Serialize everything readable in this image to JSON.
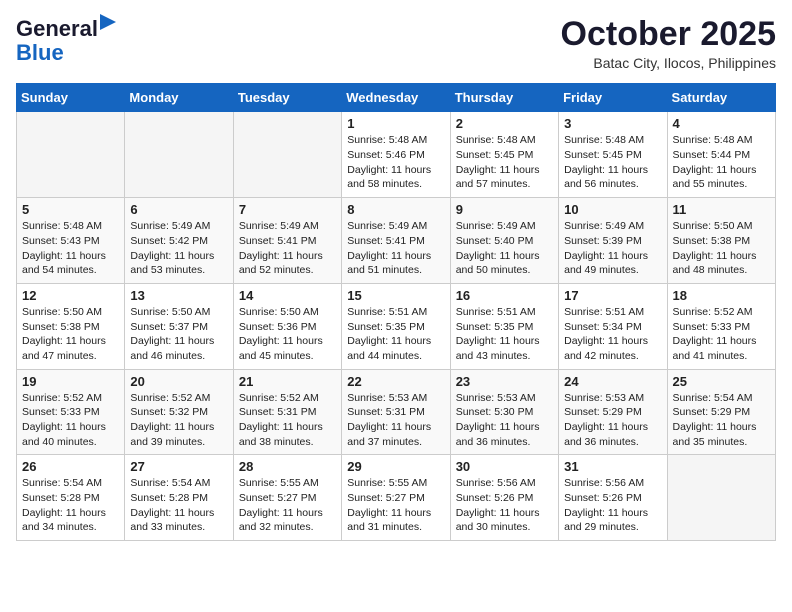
{
  "header": {
    "logo_line1": "General",
    "logo_line2": "Blue",
    "month": "October 2025",
    "location": "Batac City, Ilocos, Philippines"
  },
  "weekdays": [
    "Sunday",
    "Monday",
    "Tuesday",
    "Wednesday",
    "Thursday",
    "Friday",
    "Saturday"
  ],
  "weeks": [
    [
      {
        "day": "",
        "content": ""
      },
      {
        "day": "",
        "content": ""
      },
      {
        "day": "",
        "content": ""
      },
      {
        "day": "1",
        "content": "Sunrise: 5:48 AM\nSunset: 5:46 PM\nDaylight: 11 hours\nand 58 minutes."
      },
      {
        "day": "2",
        "content": "Sunrise: 5:48 AM\nSunset: 5:45 PM\nDaylight: 11 hours\nand 57 minutes."
      },
      {
        "day": "3",
        "content": "Sunrise: 5:48 AM\nSunset: 5:45 PM\nDaylight: 11 hours\nand 56 minutes."
      },
      {
        "day": "4",
        "content": "Sunrise: 5:48 AM\nSunset: 5:44 PM\nDaylight: 11 hours\nand 55 minutes."
      }
    ],
    [
      {
        "day": "5",
        "content": "Sunrise: 5:48 AM\nSunset: 5:43 PM\nDaylight: 11 hours\nand 54 minutes."
      },
      {
        "day": "6",
        "content": "Sunrise: 5:49 AM\nSunset: 5:42 PM\nDaylight: 11 hours\nand 53 minutes."
      },
      {
        "day": "7",
        "content": "Sunrise: 5:49 AM\nSunset: 5:41 PM\nDaylight: 11 hours\nand 52 minutes."
      },
      {
        "day": "8",
        "content": "Sunrise: 5:49 AM\nSunset: 5:41 PM\nDaylight: 11 hours\nand 51 minutes."
      },
      {
        "day": "9",
        "content": "Sunrise: 5:49 AM\nSunset: 5:40 PM\nDaylight: 11 hours\nand 50 minutes."
      },
      {
        "day": "10",
        "content": "Sunrise: 5:49 AM\nSunset: 5:39 PM\nDaylight: 11 hours\nand 49 minutes."
      },
      {
        "day": "11",
        "content": "Sunrise: 5:50 AM\nSunset: 5:38 PM\nDaylight: 11 hours\nand 48 minutes."
      }
    ],
    [
      {
        "day": "12",
        "content": "Sunrise: 5:50 AM\nSunset: 5:38 PM\nDaylight: 11 hours\nand 47 minutes."
      },
      {
        "day": "13",
        "content": "Sunrise: 5:50 AM\nSunset: 5:37 PM\nDaylight: 11 hours\nand 46 minutes."
      },
      {
        "day": "14",
        "content": "Sunrise: 5:50 AM\nSunset: 5:36 PM\nDaylight: 11 hours\nand 45 minutes."
      },
      {
        "day": "15",
        "content": "Sunrise: 5:51 AM\nSunset: 5:35 PM\nDaylight: 11 hours\nand 44 minutes."
      },
      {
        "day": "16",
        "content": "Sunrise: 5:51 AM\nSunset: 5:35 PM\nDaylight: 11 hours\nand 43 minutes."
      },
      {
        "day": "17",
        "content": "Sunrise: 5:51 AM\nSunset: 5:34 PM\nDaylight: 11 hours\nand 42 minutes."
      },
      {
        "day": "18",
        "content": "Sunrise: 5:52 AM\nSunset: 5:33 PM\nDaylight: 11 hours\nand 41 minutes."
      }
    ],
    [
      {
        "day": "19",
        "content": "Sunrise: 5:52 AM\nSunset: 5:33 PM\nDaylight: 11 hours\nand 40 minutes."
      },
      {
        "day": "20",
        "content": "Sunrise: 5:52 AM\nSunset: 5:32 PM\nDaylight: 11 hours\nand 39 minutes."
      },
      {
        "day": "21",
        "content": "Sunrise: 5:52 AM\nSunset: 5:31 PM\nDaylight: 11 hours\nand 38 minutes."
      },
      {
        "day": "22",
        "content": "Sunrise: 5:53 AM\nSunset: 5:31 PM\nDaylight: 11 hours\nand 37 minutes."
      },
      {
        "day": "23",
        "content": "Sunrise: 5:53 AM\nSunset: 5:30 PM\nDaylight: 11 hours\nand 36 minutes."
      },
      {
        "day": "24",
        "content": "Sunrise: 5:53 AM\nSunset: 5:29 PM\nDaylight: 11 hours\nand 36 minutes."
      },
      {
        "day": "25",
        "content": "Sunrise: 5:54 AM\nSunset: 5:29 PM\nDaylight: 11 hours\nand 35 minutes."
      }
    ],
    [
      {
        "day": "26",
        "content": "Sunrise: 5:54 AM\nSunset: 5:28 PM\nDaylight: 11 hours\nand 34 minutes."
      },
      {
        "day": "27",
        "content": "Sunrise: 5:54 AM\nSunset: 5:28 PM\nDaylight: 11 hours\nand 33 minutes."
      },
      {
        "day": "28",
        "content": "Sunrise: 5:55 AM\nSunset: 5:27 PM\nDaylight: 11 hours\nand 32 minutes."
      },
      {
        "day": "29",
        "content": "Sunrise: 5:55 AM\nSunset: 5:27 PM\nDaylight: 11 hours\nand 31 minutes."
      },
      {
        "day": "30",
        "content": "Sunrise: 5:56 AM\nSunset: 5:26 PM\nDaylight: 11 hours\nand 30 minutes."
      },
      {
        "day": "31",
        "content": "Sunrise: 5:56 AM\nSunset: 5:26 PM\nDaylight: 11 hours\nand 29 minutes."
      },
      {
        "day": "",
        "content": ""
      }
    ]
  ]
}
